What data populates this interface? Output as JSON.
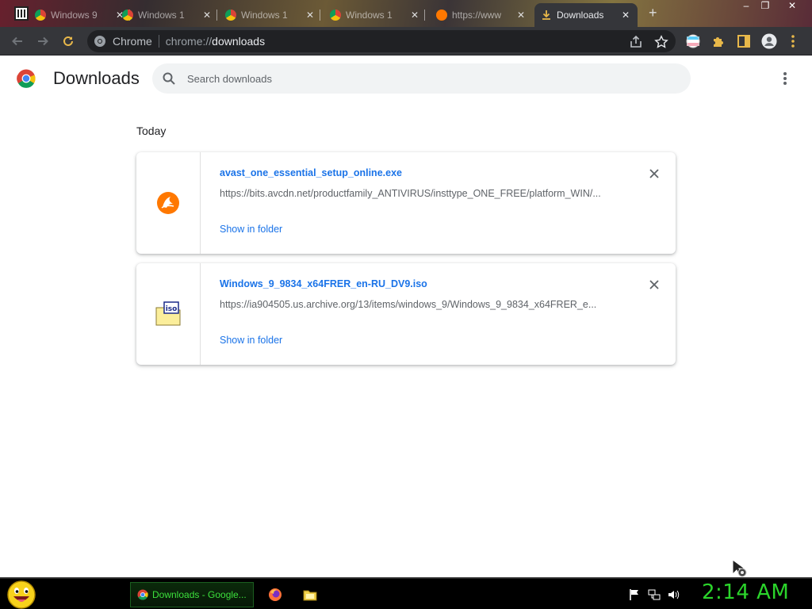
{
  "tabs": [
    {
      "title": "Windows 9",
      "favicon": "chrome-favicon",
      "active": false
    },
    {
      "title": "Windows 1",
      "favicon": "chrome-favicon",
      "active": false
    },
    {
      "title": "Windows 1",
      "favicon": "chrome-favicon",
      "active": false
    },
    {
      "title": "Windows 1",
      "favicon": "chrome-favicon",
      "active": false
    },
    {
      "title": "https://www",
      "favicon": "avast-favicon",
      "active": false
    },
    {
      "title": "Downloads",
      "favicon": "download-favicon",
      "active": true
    }
  ],
  "toolbar": {
    "omnibox_label": "Chrome",
    "url_scheme": "chrome://",
    "url_host": "downloads"
  },
  "header": {
    "title": "Downloads",
    "search_placeholder": "Search downloads"
  },
  "content": {
    "date_heading": "Today",
    "downloads": [
      {
        "file_name": "avast_one_essential_setup_online.exe",
        "url": "https://bits.avcdn.net/productfamily_ANTIVIRUS/insttype_ONE_FREE/platform_WIN/...",
        "action": "Show in folder",
        "icon": "avast-icon"
      },
      {
        "file_name": "Windows_9_9834_x64FRER_en-RU_DV9.iso",
        "url": "https://ia904505.us.archive.org/13/items/windows_9/Windows_9_9834_x64FRER_e...",
        "action": "Show in folder",
        "icon": "iso-file-icon"
      }
    ]
  },
  "taskbar": {
    "active_task": "Downloads - Google...",
    "clock": "2:14 AM"
  },
  "colors": {
    "link_blue": "#1a73e8",
    "taskbar_green": "#2bd42b",
    "toolbar_dark": "#35363a"
  }
}
